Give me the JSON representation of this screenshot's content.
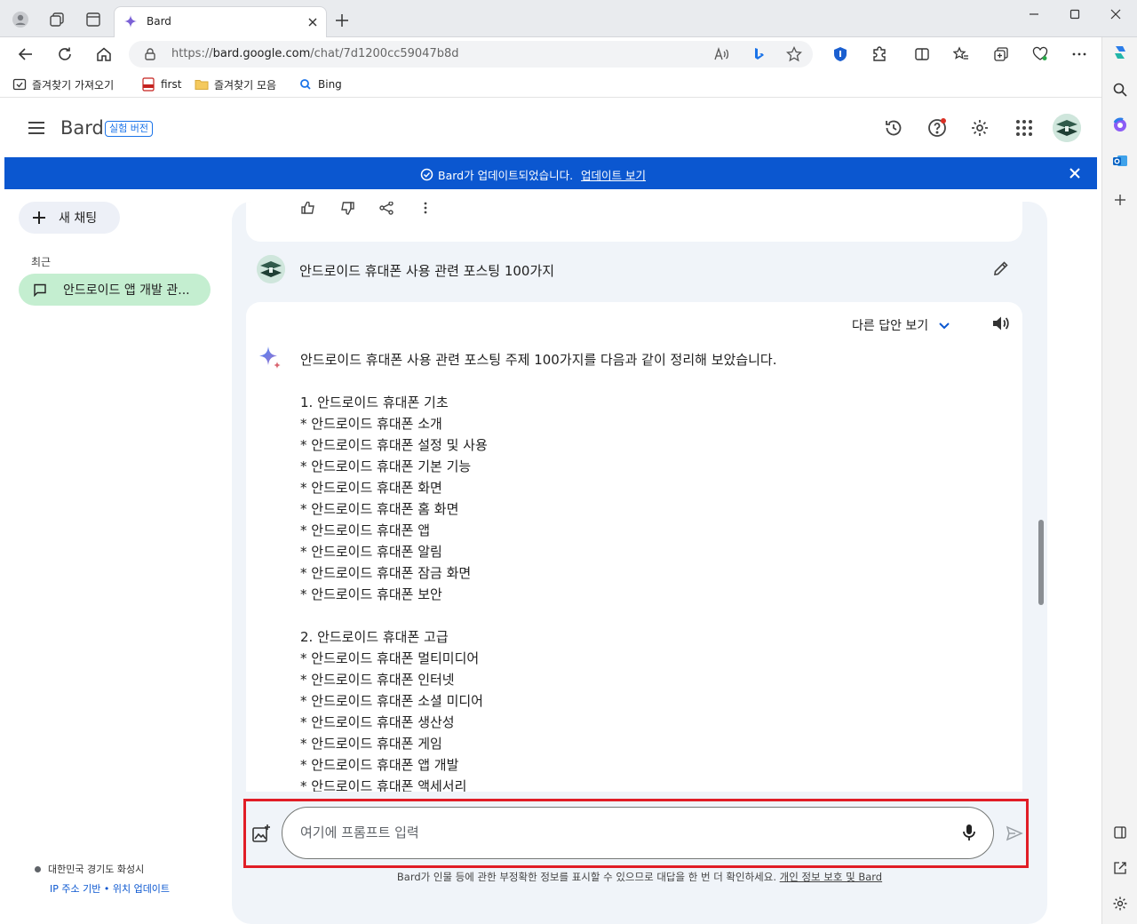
{
  "browser": {
    "tab_title": "Bard",
    "url_prefix": "https://",
    "url_domain": "bard.google.com",
    "url_path": "/chat/7d1200cc59047b8d",
    "favorites": [
      {
        "label": "즐겨찾기 가져오기",
        "icon": "import-icon"
      },
      {
        "label": "first",
        "icon": "pdf-icon"
      },
      {
        "label": "즐겨찾기 모음",
        "icon": "folder-icon"
      },
      {
        "label": "Bing",
        "icon": "search-icon"
      }
    ]
  },
  "app": {
    "brand": "Bard",
    "badge": "실험 버전"
  },
  "banner": {
    "text": "Bard가 업데이트되었습니다.",
    "link": "업데이트 보기"
  },
  "sidebar": {
    "new_chat": "새 채팅",
    "recent_heading": "최근",
    "recent_items": [
      {
        "label": "안드로이드 앱 개발 관..."
      }
    ],
    "location": "대한민국 경기도 화성시",
    "location_links": "IP 주소 기반 • 위치 업데이트"
  },
  "chat": {
    "prompt": "안드로이드 휴대폰 사용 관련 포스팅 100가지",
    "other_answers": "다른 답안 보기",
    "response_intro": "안드로이드 휴대폰 사용 관련 포스팅 주제 100가지를 다음과 같이 정리해 보았습니다.",
    "sections": [
      {
        "heading": "1. 안드로이드 휴대폰 기초",
        "items": [
          "* 안드로이드 휴대폰 소개",
          "* 안드로이드 휴대폰 설정 및 사용",
          "* 안드로이드 휴대폰 기본 기능",
          "* 안드로이드 휴대폰 화면",
          "* 안드로이드 휴대폰 홈 화면",
          "* 안드로이드 휴대폰 앱",
          "* 안드로이드 휴대폰 알림",
          "* 안드로이드 휴대폰 잠금 화면",
          "* 안드로이드 휴대폰 보안"
        ]
      },
      {
        "heading": "2. 안드로이드 휴대폰 고급",
        "items": [
          "* 안드로이드 휴대폰 멀티미디어",
          "* 안드로이드 휴대폰 인터넷",
          "* 안드로이드 휴대폰 소셜 미디어",
          "* 안드로이드 휴대폰 생산성",
          "* 안드로이드 휴대폰 게임",
          "* 안드로이드 휴대폰 앱 개발",
          "* 안드로이드 휴대폰 액세서리"
        ]
      }
    ]
  },
  "input": {
    "placeholder": "여기에 프롬프트 입력",
    "value": ""
  },
  "disclaimer": {
    "text": "Bard가 인물 등에 관한 부정확한 정보를 표시할 수 있으므로 대답을 한 번 더 확인하세요. ",
    "link": "개인 정보 보호 및 Bard"
  },
  "colors": {
    "banner": "#0b57d0",
    "recent_highlight": "#c4eed0",
    "panel_bg": "#f0f4f9",
    "input_highlight": "#e11d26"
  }
}
